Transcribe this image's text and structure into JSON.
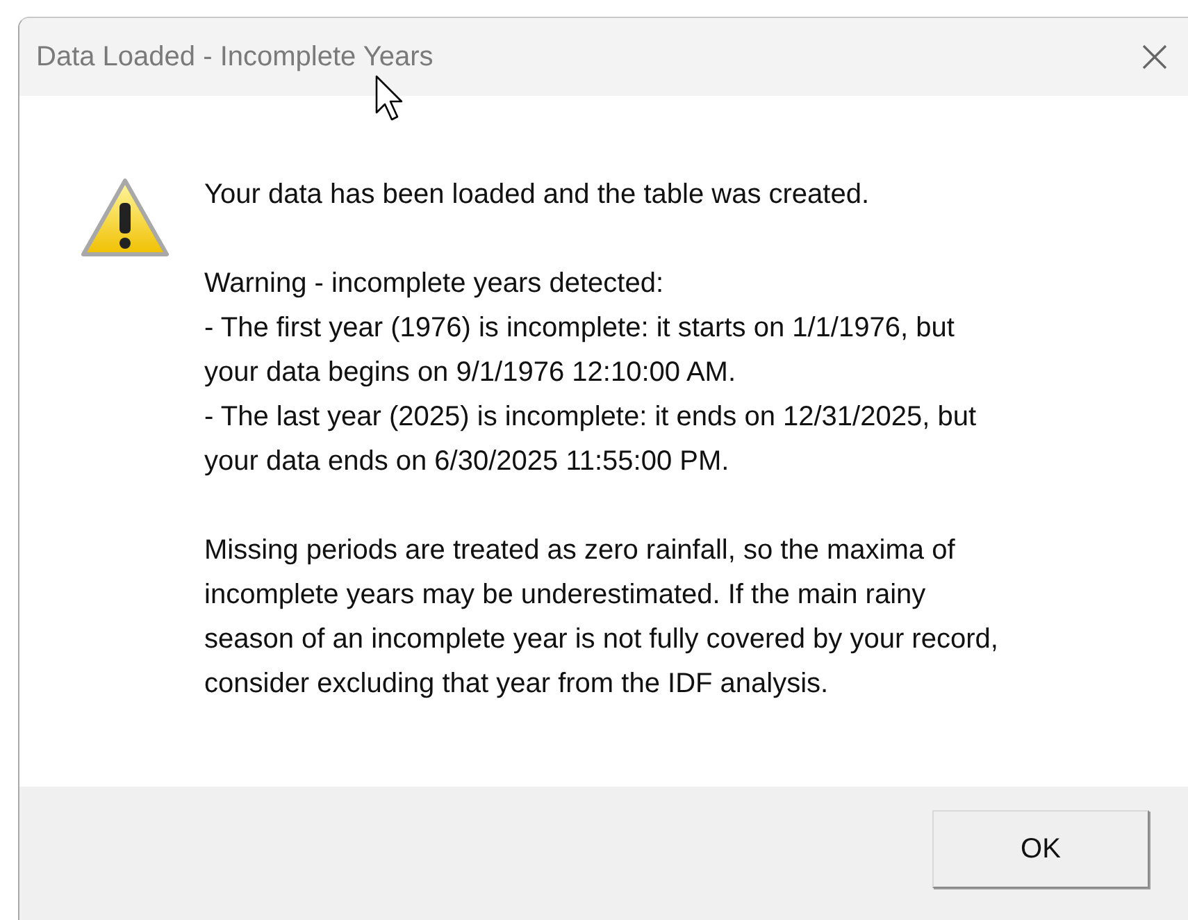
{
  "window": {
    "title": "Data Loaded - Incomplete Years"
  },
  "message": {
    "paragraphs": [
      [
        "Your data has been loaded and the table was created."
      ],
      [
        "Warning - incomplete years detected:",
        "- The first year (1976) is incomplete: it starts on 1/1/1976, but",
        "your data begins on 9/1/1976 12:10:00 AM.",
        "- The last year (2025) is incomplete: it ends on 12/31/2025, but",
        "your data ends on 6/30/2025 11:55:00 PM."
      ],
      [
        "Missing periods are treated as zero rainfall, so the maxima of",
        "incomplete years may be underestimated. If the main rainy",
        "season of an incomplete year is not fully covered by your record,",
        "consider excluding that year from the IDF analysis."
      ]
    ]
  },
  "buttons": [
    "OK"
  ]
}
